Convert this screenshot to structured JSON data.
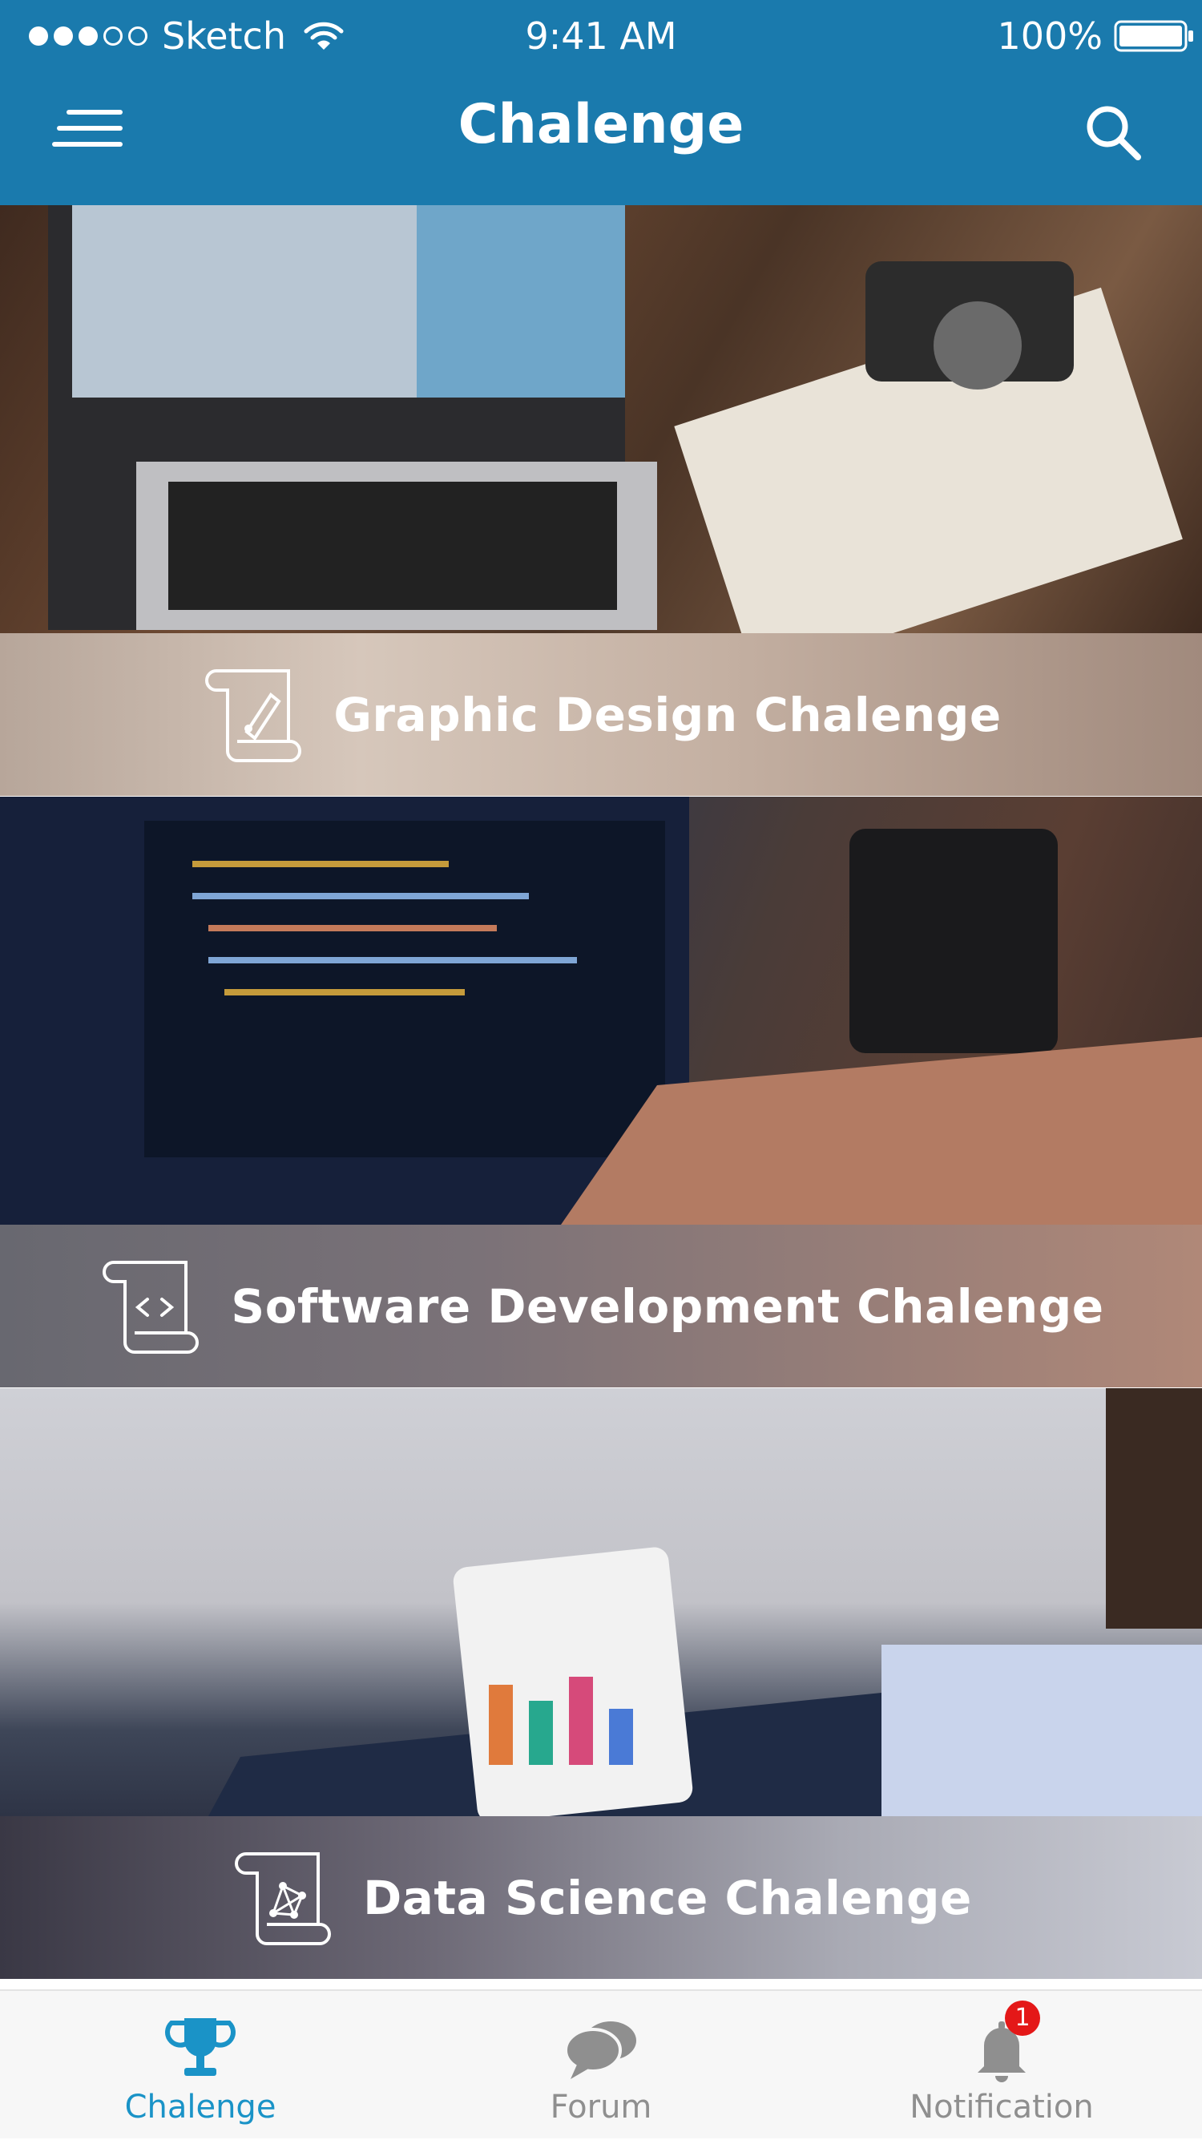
{
  "status_bar": {
    "carrier": "Sketch",
    "time": "9:41 AM",
    "battery": "100%"
  },
  "header": {
    "title": "Chalenge",
    "menu_icon": "menu-icon",
    "search_icon": "search-icon"
  },
  "cards": [
    {
      "label": "Graphic Design Chalenge",
      "icon": "scroll-pen-icon"
    },
    {
      "label": "Software Development Chalenge",
      "icon": "scroll-code-icon"
    },
    {
      "label": "Data Science Chalenge",
      "icon": "scroll-graph-icon"
    }
  ],
  "tabs": [
    {
      "label": "Chalenge",
      "icon": "trophy-icon",
      "active": true
    },
    {
      "label": "Forum",
      "icon": "chat-bubbles-icon",
      "active": false
    },
    {
      "label": "Notification",
      "icon": "bell-icon",
      "active": false,
      "badge": "1"
    }
  ],
  "colors": {
    "header_bg": "#1a7aad",
    "tab_active": "#1a93c7",
    "tab_inactive": "#8f8f8f",
    "badge": "#e41818"
  }
}
